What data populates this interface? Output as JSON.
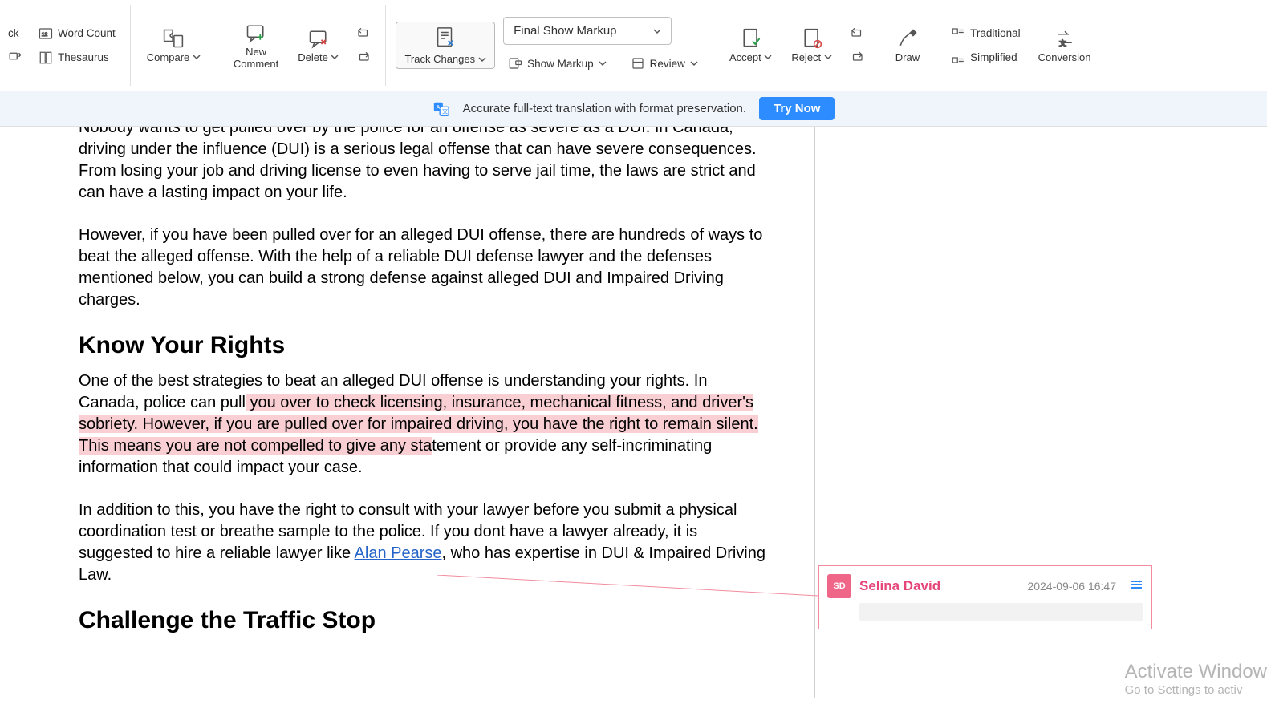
{
  "ribbon": {
    "proofing": {
      "check": "ck",
      "wordcount": "Word Count",
      "thesaurus": "Thesaurus"
    },
    "compare": {
      "label": "Compare"
    },
    "comments": {
      "new": "New\nComment",
      "delete": "Delete"
    },
    "tracking": {
      "track_changes": "Track Changes",
      "display_mode": "Final Show Markup",
      "show_markup": "Show Markup",
      "review": "Review"
    },
    "changes": {
      "accept": "Accept",
      "reject": "Reject"
    },
    "draw": {
      "label": "Draw"
    },
    "chinese": {
      "traditional": "Traditional",
      "simplified": "Simplified",
      "conversion": "Conversion"
    }
  },
  "banner": {
    "text": "Accurate full-text translation with format preservation.",
    "cta": "Try Now"
  },
  "document": {
    "p1": "Nobody wants to get pulled over by the police for an offense as severe as a DUI. In Canada, driving under the influence (DUI) is a serious legal offense that can have severe consequences. From losing your job and driving license to even having to serve jail time, the laws are strict and can have a lasting impact on your life.",
    "p2": "However, if you have been pulled over for an alleged DUI offense, there are hundreds of ways to beat the alleged offense. With the help of a reliable DUI defense lawyer and the defenses mentioned below, you can build a strong defense against alleged DUI and Impaired Driving charges.",
    "h2a": "Know Your Rights",
    "p3_pre": "One of the best strategies to beat an alleged DUI offense is understanding your rights. In Canada, police can pull",
    "p3_hl": " you over to check licensing, insurance, mechanical fitness, and driver's sobriety. However, if you are pulled over for impaired driving, you have the right to remain silent. This means you are not compelled to give any sta",
    "p3_post": "tement or provide any self-incriminating information that could impact your case.",
    "p4_pre": "In addition to this, you have the right to consult with your lawyer before you submit a physical coordination test or breathe sample to the police. If you dont have a lawyer already, it is suggested to hire a reliable lawyer like ",
    "p4_link": "Alan Pearse",
    "p4_post": ", who has expertise in DUI & Impaired Driving Law.",
    "h2b": "Challenge the Traffic Stop"
  },
  "comment": {
    "initials": "SD",
    "author": "Selina David",
    "timestamp": "2024-09-06 16:47"
  },
  "watermark": {
    "line1": "Activate Window",
    "line2": "Go to Settings to activ"
  }
}
